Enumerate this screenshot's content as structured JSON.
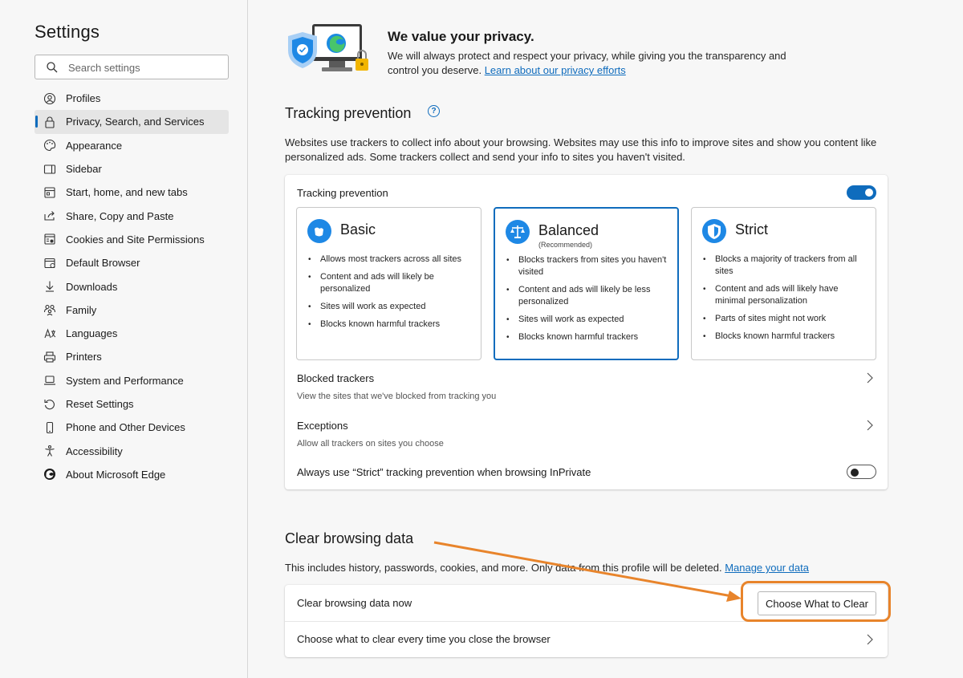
{
  "sidebar": {
    "title": "Settings",
    "search_placeholder": "Search settings",
    "items": [
      {
        "label": "Profiles",
        "icon": "profile-icon"
      },
      {
        "label": "Privacy, Search, and Services",
        "icon": "lock-icon"
      },
      {
        "label": "Appearance",
        "icon": "palette-icon"
      },
      {
        "label": "Sidebar",
        "icon": "sidebar-icon"
      },
      {
        "label": "Start, home, and new tabs",
        "icon": "home-icon"
      },
      {
        "label": "Share, Copy and Paste",
        "icon": "share-icon"
      },
      {
        "label": "Cookies and Site Permissions",
        "icon": "site-permissions-icon"
      },
      {
        "label": "Default Browser",
        "icon": "browser-icon"
      },
      {
        "label": "Downloads",
        "icon": "download-icon"
      },
      {
        "label": "Family",
        "icon": "family-icon"
      },
      {
        "label": "Languages",
        "icon": "languages-icon"
      },
      {
        "label": "Printers",
        "icon": "printer-icon"
      },
      {
        "label": "System and Performance",
        "icon": "laptop-icon"
      },
      {
        "label": "Reset Settings",
        "icon": "reset-icon"
      },
      {
        "label": "Phone and Other Devices",
        "icon": "phone-icon"
      },
      {
        "label": "Accessibility",
        "icon": "accessibility-icon"
      },
      {
        "label": "About Microsoft Edge",
        "icon": "edge-logo-icon"
      }
    ],
    "active_index": 1
  },
  "privacy": {
    "title": "We value your privacy.",
    "desc_1": "We will always protect and respect your privacy, while giving you the transparency and control you deserve.",
    "link": "Learn about our privacy efforts"
  },
  "tracking": {
    "title": "Tracking prevention",
    "desc": "Websites use trackers to collect info about your browsing. Websites may use this info to improve sites and show you content like personalized ads. Some trackers collect and send your info to sites you haven't visited.",
    "card_label": "Tracking prevention",
    "enabled": true,
    "levels": [
      {
        "name": "Basic",
        "sub": "",
        "bullets": [
          "Allows most trackers across all sites",
          "Content and ads will likely be personalized",
          "Sites will work as expected",
          "Blocks known harmful trackers"
        ]
      },
      {
        "name": "Balanced",
        "sub": "(Recommended)",
        "bullets": [
          "Blocks trackers from sites you haven't visited",
          "Content and ads will likely be less personalized",
          "Sites will work as expected",
          "Blocks known harmful trackers"
        ]
      },
      {
        "name": "Strict",
        "sub": "",
        "bullets": [
          "Blocks a majority of trackers from all sites",
          "Content and ads will likely have minimal personalization",
          "Parts of sites might not work",
          "Blocks known harmful trackers"
        ]
      }
    ],
    "selected": "Balanced",
    "blocked_title": "Blocked trackers",
    "blocked_sub": "View the sites that we've blocked from tracking you",
    "exceptions_title": "Exceptions",
    "exceptions_sub": "Allow all trackers on sites you choose",
    "strict_inprivate": "Always use “Strict” tracking prevention when browsing InPrivate",
    "strict_inprivate_enabled": false
  },
  "clear": {
    "title": "Clear browsing data",
    "desc": "This includes history, passwords, cookies, and more. Only data from this profile will be deleted.",
    "link": "Manage your data",
    "now_label": "Clear browsing data now",
    "button": "Choose What to Clear",
    "on_close_label": "Choose what to clear every time you close the browser"
  },
  "colors": {
    "accent": "#0f6cbd",
    "annotation": "#e8842b"
  }
}
